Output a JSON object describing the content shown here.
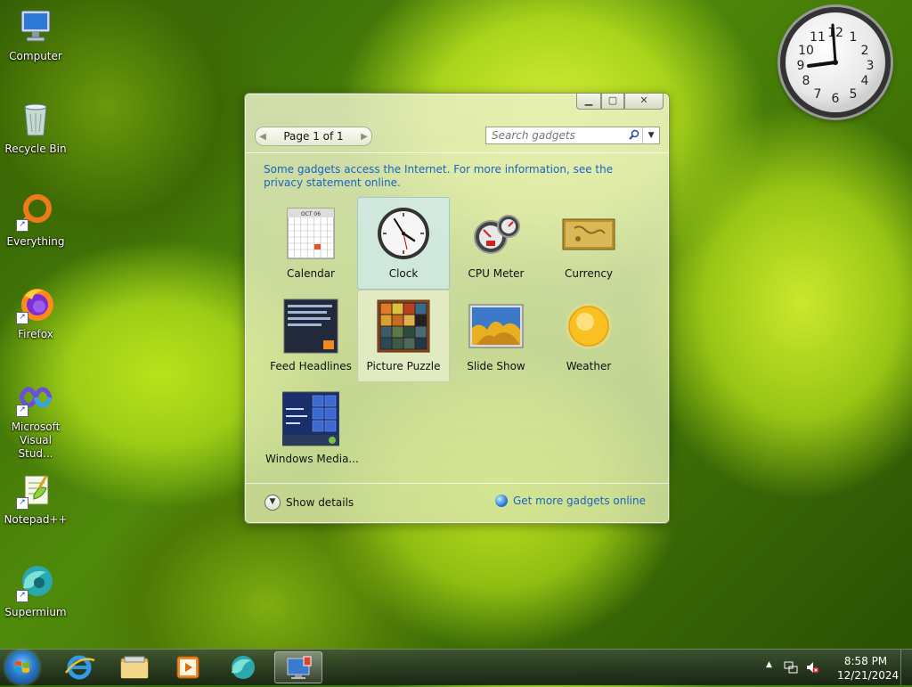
{
  "desktop": {
    "icons": [
      {
        "label": "Computer"
      },
      {
        "label": "Recycle Bin"
      },
      {
        "label": "Everything"
      },
      {
        "label": "Firefox"
      },
      {
        "label": "Microsoft Visual Stud..."
      },
      {
        "label": "Notepad++"
      },
      {
        "label": "Supermium"
      }
    ],
    "clock_gadget": {
      "numbers": [
        "12",
        "1",
        "2",
        "3",
        "4",
        "5",
        "6",
        "7",
        "8",
        "9",
        "10",
        "11"
      ],
      "time": "8:58"
    }
  },
  "gallery": {
    "pager": {
      "label": "Page 1 of 1"
    },
    "search": {
      "placeholder": "Search gadgets"
    },
    "notice": "Some gadgets access the Internet.  For more information, see the privacy statement online.",
    "gadgets": [
      {
        "name": "Calendar"
      },
      {
        "name": "Clock"
      },
      {
        "name": "CPU Meter"
      },
      {
        "name": "Currency"
      },
      {
        "name": "Feed Headlines"
      },
      {
        "name": "Picture Puzzle"
      },
      {
        "name": "Slide Show"
      },
      {
        "name": "Weather"
      },
      {
        "name": "Windows Media..."
      }
    ],
    "calendar_thumb": {
      "month": "OCT 06"
    },
    "show_details": "Show details",
    "more_gadgets": "Get more gadgets online"
  },
  "taskbar": {
    "time": "8:58 PM",
    "date": "12/21/2024"
  },
  "colors": {
    "link": "#1a63c4",
    "taskbar": "#2b3a26"
  }
}
